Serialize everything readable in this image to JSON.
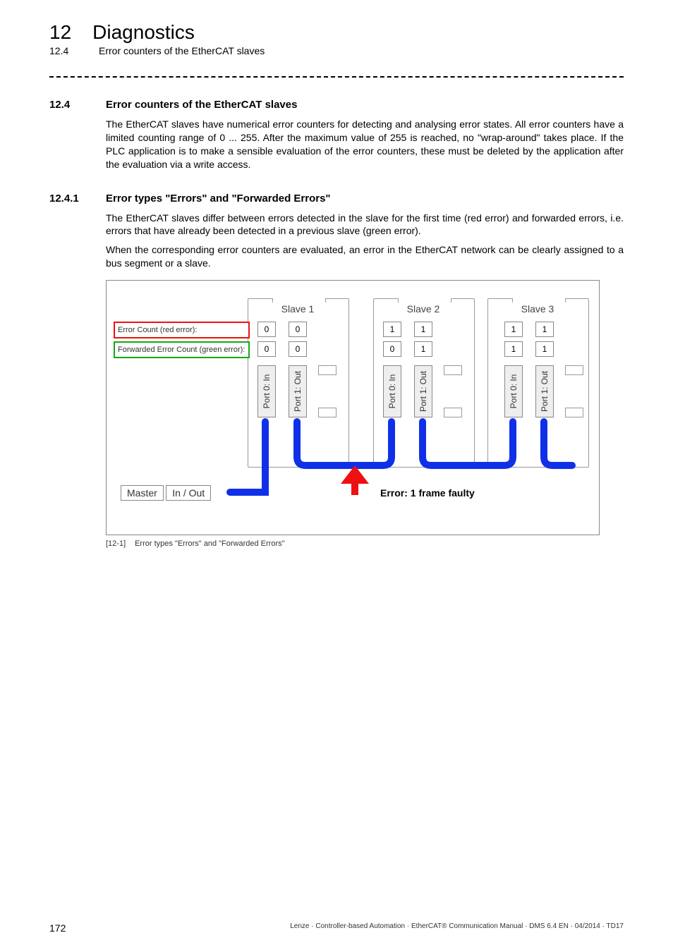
{
  "header": {
    "chapter_number": "12",
    "chapter_title": "Diagnostics",
    "sub_number": "12.4",
    "sub_title": "Error counters of the EtherCAT slaves"
  },
  "section_12_4": {
    "number": "12.4",
    "title": "Error counters of the EtherCAT slaves",
    "para": "The EtherCAT slaves have numerical error counters for detecting and analysing error states. All error counters have a limited counting range of 0 ... 255. After the maximum value of 255 is reached, no \"wrap-around\" takes place. If the PLC application is to make a sensible evaluation of the error counters, these must be deleted by the application after the evaluation via a write access."
  },
  "section_12_4_1": {
    "number": "12.4.1",
    "title": "Error types \"Errors\" and \"Forwarded Errors\"",
    "para1": "The EtherCAT slaves differ between errors detected in the slave for the first time (red error) and forwarded errors, i.e. errors that have already been detected in a previous slave (green error).",
    "para2": "When the corresponding error counters are evaluated, an error in the EtherCAT network can be clearly assigned to a bus segment or a slave."
  },
  "figure": {
    "slaves": [
      "Slave 1",
      "Slave 2",
      "Slave 3"
    ],
    "row_red_label": "Error Count (red error):",
    "row_green_label": "Forwarded Error Count (green error):",
    "red_counts": [
      [
        "0",
        "0"
      ],
      [
        "1",
        "1"
      ],
      [
        "1",
        "1"
      ]
    ],
    "green_counts": [
      [
        "0",
        "0"
      ],
      [
        "0",
        "1"
      ],
      [
        "1",
        "1"
      ]
    ],
    "port_in": "Port 0: In",
    "port_out": "Port 1: Out",
    "master_label": "Master",
    "master_inout": "In / Out",
    "error_label": "Error: 1 frame faulty",
    "caption_tag": "[12-1]",
    "caption_text": "Error types \"Errors\" and \"Forwarded Errors\""
  },
  "footer": {
    "page": "172",
    "text": "Lenze · Controller-based Automation · EtherCAT® Communication Manual · DMS 6.4 EN · 04/2014 · TD17"
  }
}
